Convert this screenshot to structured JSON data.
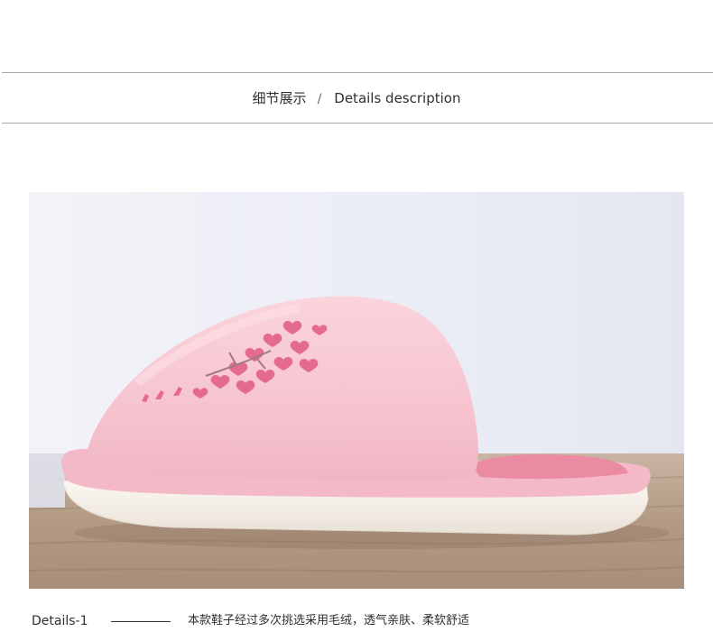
{
  "section_header": {
    "chinese_title": "细节展示",
    "separator": "/",
    "english_title": "Details description"
  },
  "photo": {
    "subject": "pink-slipper-side-view",
    "colors": {
      "background_wall": "#eeeff6",
      "floor": "#b9a28c",
      "slipper_pink": "#f6c7d1",
      "sole": "#f7f2ea",
      "hearts": "#e56a8f"
    }
  },
  "detail": {
    "label": "Details-1",
    "description": "本款鞋子经过多次挑选采用毛绒，透气亲肤、柔软舒适"
  }
}
